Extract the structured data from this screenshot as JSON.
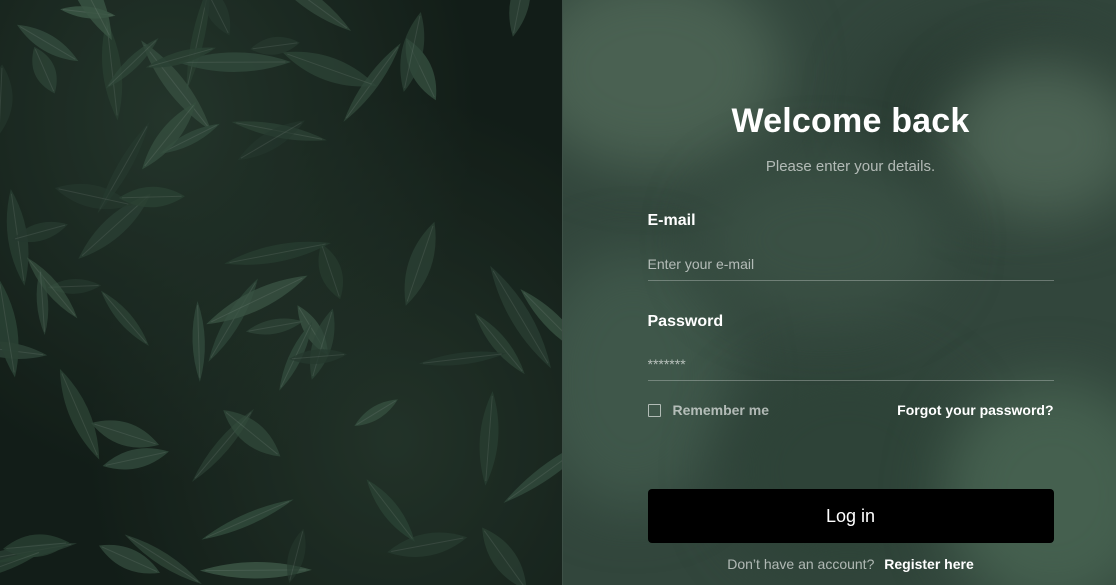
{
  "login": {
    "title": "Welcome back",
    "subtitle": "Please enter your details.",
    "email": {
      "label": "E-mail",
      "placeholder": "Enter your e-mail",
      "value": ""
    },
    "password": {
      "label": "Password",
      "placeholder": "*******",
      "value": ""
    },
    "remember_label": "Remember me",
    "remember_checked": false,
    "forgot_label": "Forgot your password?",
    "submit_label": "Log in",
    "register_prompt": "Don’t have an account?",
    "register_link": "Register here"
  },
  "colors": {
    "button_bg": "#000000",
    "panel_bg": "#32463c",
    "foliage": "#3d5a49"
  }
}
